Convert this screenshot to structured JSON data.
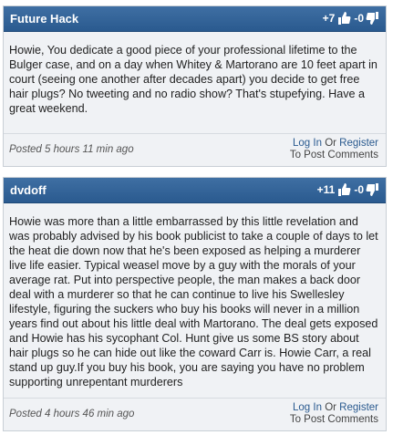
{
  "comments": [
    {
      "author": "Future Hack",
      "up_votes": "+7",
      "down_votes": "-0",
      "text": "Howie, You dedicate a good piece of your professional lifetime to the Bulger case, and on a day when Whitey & Martorano are 10 feet apart in court (seeing one another after decades apart) you decide to get free hair plugs? No tweeting and no radio show? That's stupefying. Have a great weekend.",
      "posted": "Posted 5 hours 11 min ago",
      "login": "Log In",
      "or": "Or",
      "register": "Register",
      "to_post": "To Post Comments"
    },
    {
      "author": "dvdoff",
      "up_votes": "+11",
      "down_votes": "-0",
      "text": "Howie was more than a little embarrassed by this little revelation and was probably advised by his book publicist to take a couple of days to let the heat die down now that he's been exposed as helping a murderer live life easier. Typical weasel move by a guy with the morals of your average rat. Put into perspective people, the man makes a back door deal with a murderer so that he can continue to live his Swellesley lifestyle, figuring the suckers who buy his books will never in a million years find out about his little deal with Martorano. The deal gets exposed and Howie has his sycophant Col. Hunt give us some BS story about hair plugs so he can hide out like the coward Carr is. Howie Carr, a real stand up guy.If you buy his book, you are saying you have no problem supporting unrepentant murderers",
      "posted": "Posted 4 hours 46 min ago",
      "login": "Log In",
      "or": "Or",
      "register": "Register",
      "to_post": "To Post Comments"
    }
  ],
  "icons": {
    "thumb_up": "thumbs-up-icon",
    "thumb_down": "thumbs-down-icon"
  },
  "colors": {
    "header": "#2f6096",
    "body_bg": "#f0f2f5",
    "link": "#2a5a8f"
  }
}
